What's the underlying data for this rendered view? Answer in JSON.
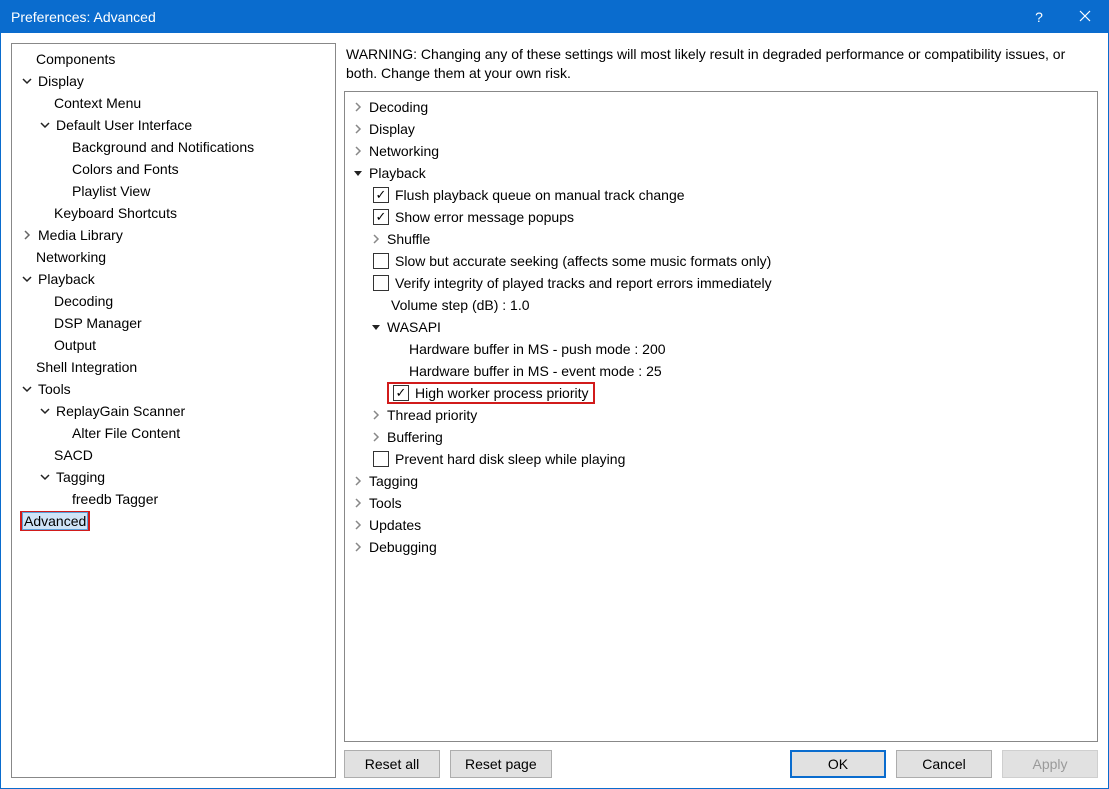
{
  "window": {
    "title": "Preferences: Advanced"
  },
  "nav": {
    "components": "Components",
    "display": "Display",
    "context_menu": "Context Menu",
    "default_ui": "Default User Interface",
    "bg_notifs": "Background and Notifications",
    "colors_fonts": "Colors and Fonts",
    "playlist_view": "Playlist View",
    "keyboard_shortcuts": "Keyboard Shortcuts",
    "media_library": "Media Library",
    "networking": "Networking",
    "playback": "Playback",
    "decoding": "Decoding",
    "dsp_manager": "DSP Manager",
    "output": "Output",
    "shell_integration": "Shell Integration",
    "tools": "Tools",
    "replaygain_scanner": "ReplayGain Scanner",
    "alter_file_content": "Alter File Content",
    "sacd": "SACD",
    "tagging": "Tagging",
    "freedb_tagger": "freedb Tagger",
    "advanced": "Advanced"
  },
  "warning_text": "WARNING: Changing any of these settings will most likely result in degraded performance or compatibility issues, or both. Change them at your own risk.",
  "settings": {
    "decoding": "Decoding",
    "display": "Display",
    "networking": "Networking",
    "playback": "Playback",
    "flush_queue": "Flush playback queue on manual track change",
    "show_error_popups": "Show error message popups",
    "shuffle": "Shuffle",
    "slow_seeking": "Slow but accurate seeking (affects some music formats only)",
    "verify_integrity": "Verify integrity of played tracks and report errors immediately",
    "volume_step": "Volume step (dB) : 1.0",
    "wasapi": "WASAPI",
    "hw_buffer_push": "Hardware buffer in MS - push mode : 200",
    "hw_buffer_event": "Hardware buffer in MS - event mode : 25",
    "high_worker": "High worker process priority",
    "thread_priority": "Thread priority",
    "buffering": "Buffering",
    "prevent_sleep": "Prevent hard disk sleep while playing",
    "tagging": "Tagging",
    "tools": "Tools",
    "updates": "Updates",
    "debugging": "Debugging"
  },
  "buttons": {
    "reset_all": "Reset all",
    "reset_page": "Reset page",
    "ok": "OK",
    "cancel": "Cancel",
    "apply": "Apply"
  }
}
